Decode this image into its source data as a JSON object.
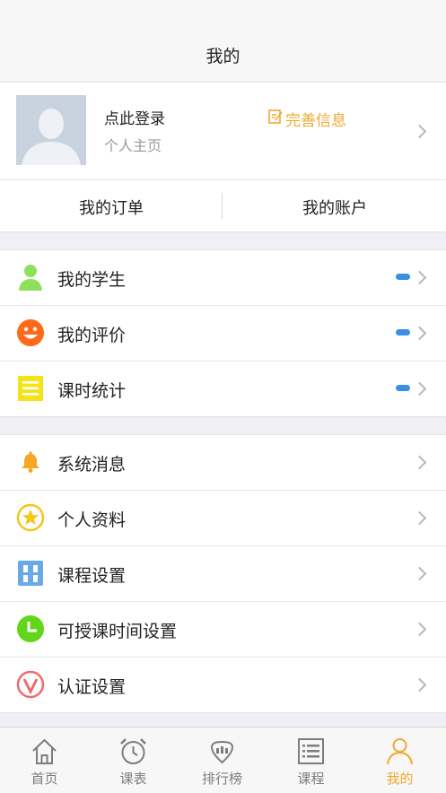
{
  "navbar": {
    "title": "我的"
  },
  "profile": {
    "login_label": "点此登录",
    "homepage_label": "个人主页",
    "complete_info_label": "完善信息"
  },
  "orders": {
    "my_orders": "我的订单",
    "my_account": "我的账户"
  },
  "group1": [
    {
      "label": "我的学生",
      "icon": "student-icon",
      "color": "#8ee05a"
    },
    {
      "label": "我的评价",
      "icon": "smiley-icon",
      "color": "#ff6a1a"
    },
    {
      "label": "课时统计",
      "icon": "list-icon",
      "color": "#f5e31a"
    }
  ],
  "group2": [
    {
      "label": "系统消息",
      "icon": "bell-icon",
      "color": "#f5a623"
    },
    {
      "label": "个人资料",
      "icon": "star-icon",
      "color": "#f5c518"
    },
    {
      "label": "课程设置",
      "icon": "grid-icon",
      "color": "#6aa9e8"
    },
    {
      "label": "可授课时间设置",
      "icon": "clock-icon",
      "color": "#62d61a"
    },
    {
      "label": "认证设置",
      "icon": "verify-icon",
      "color": "#f06b6b"
    }
  ],
  "tabs": [
    {
      "label": "首页",
      "icon": "home-icon",
      "active": false
    },
    {
      "label": "课表",
      "icon": "alarm-clock-icon",
      "active": false
    },
    {
      "label": "排行榜",
      "icon": "ranking-icon",
      "active": false
    },
    {
      "label": "课程",
      "icon": "course-list-icon",
      "active": false
    },
    {
      "label": "我的",
      "icon": "person-icon",
      "active": true
    }
  ],
  "colors": {
    "accent": "#f0a830",
    "badge": "#3b8fe0"
  }
}
